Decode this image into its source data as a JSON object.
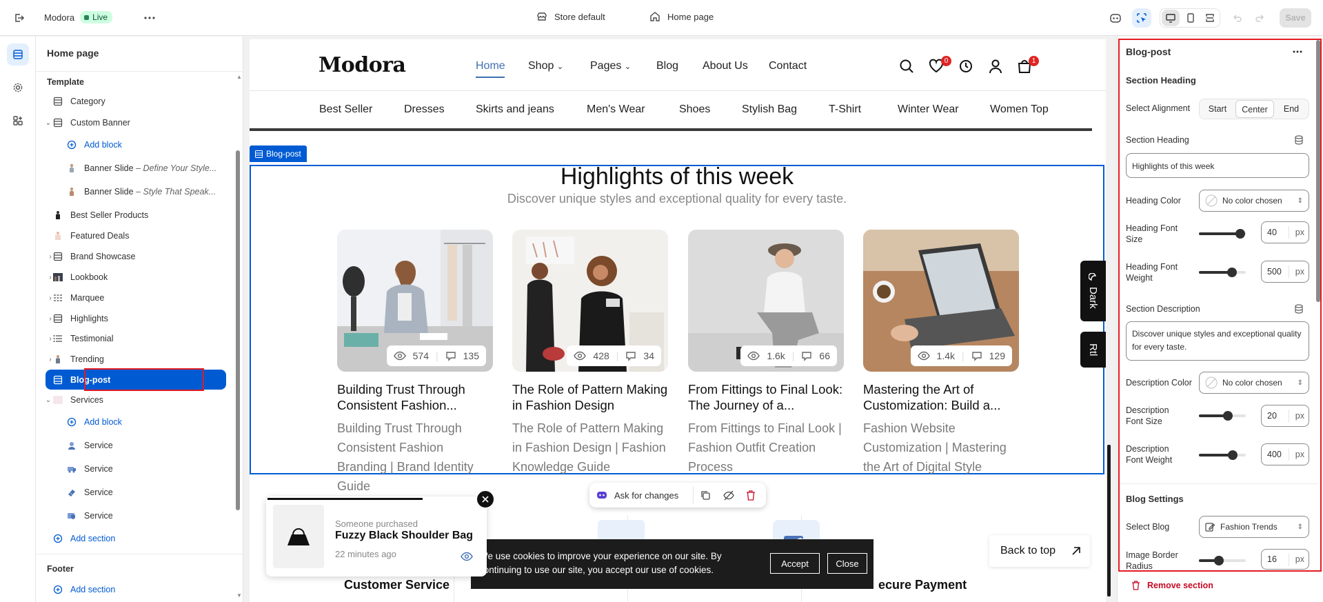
{
  "topbar": {
    "exit_icon": "exit-icon",
    "store_name": "Modora",
    "live_label": "Live",
    "more_icon": "more-icon",
    "theme_label": "Store default",
    "template_label": "Home page",
    "save_label": "Save"
  },
  "sidebar": {
    "title": "Home page",
    "template_group": "Template",
    "footer_group": "Footer",
    "items": [
      {
        "label": "Category"
      },
      {
        "label": "Custom Banner"
      },
      {
        "label": "Add block"
      },
      {
        "label": "Banner Slide",
        "sub": "– Define Your Style..."
      },
      {
        "label": "Banner Slide",
        "sub": "– Style That Speak..."
      },
      {
        "label": "Best Seller Products"
      },
      {
        "label": "Featured Deals"
      },
      {
        "label": "Brand Showcase"
      },
      {
        "label": "Lookbook"
      },
      {
        "label": "Marquee"
      },
      {
        "label": "Highlights"
      },
      {
        "label": "Testimonial"
      },
      {
        "label": "Trending"
      },
      {
        "label": "Blog-post"
      },
      {
        "label": "Services"
      },
      {
        "label": "Add block"
      },
      {
        "label": "Service"
      },
      {
        "label": "Service"
      },
      {
        "label": "Service"
      },
      {
        "label": "Service"
      },
      {
        "label": "Add section"
      }
    ],
    "footer_add": "Add section"
  },
  "site": {
    "logo": "Modora",
    "nav": [
      "Home",
      "Shop",
      "Pages",
      "Blog",
      "About Us",
      "Contact"
    ],
    "wishlist_count": "0",
    "cart_count": "1",
    "categories": [
      "Best Seller",
      "Dresses",
      "Skirts and jeans",
      "Men's Wear",
      "Shoes",
      "Stylish Bag",
      "T-Shirt",
      "Winter Wear",
      "Women Top"
    ]
  },
  "section": {
    "tag": "Blog-post",
    "heading": "Highlights of this week",
    "subheading": "Discover unique styles and exceptional quality for every taste."
  },
  "posts": [
    {
      "title": "Building Trust Through Consistent Fashion...",
      "desc": "Building Trust Through Consistent Fashion Branding | Brand Identity Guide",
      "views": "574",
      "comments": "135"
    },
    {
      "title": "The Role of Pattern Making in Fashion Design",
      "desc": "The Role of Pattern Making in Fashion Design | Fashion Knowledge Guide",
      "views": "428",
      "comments": "34"
    },
    {
      "title": "From Fittings to Final Look: The Journey of a...",
      "desc": "From Fittings to Final Look | Fashion Outfit Creation Process",
      "views": "1.6k",
      "comments": "66"
    },
    {
      "title": "Mastering the Art of Customization: Build a...",
      "desc": "Fashion Website Customization | Mastering the Art of Digital Style",
      "views": "1.4k",
      "comments": "129"
    }
  ],
  "side_tabs": {
    "dark": "Dark",
    "rtl": "Rtl"
  },
  "ask_bar": {
    "label": "Ask for changes"
  },
  "toast": {
    "caption": "Someone purchased",
    "product": "Fuzzy Black Shoulder Bag",
    "time": "22 minutes ago"
  },
  "services": {
    "left": "Customer Service",
    "right": "ecure Payment"
  },
  "cookie": {
    "text": "We use cookies to improve your experience on our site. By continuing to use our site, you accept our use of cookies.",
    "accept": "Accept",
    "close": "Close"
  },
  "back_to_top": "Back to top",
  "panel": {
    "title": "Blog-post",
    "section_heading": "Section Heading",
    "select_alignment": "Select Alignment",
    "align_options": [
      "Start",
      "Center",
      "End"
    ],
    "heading_label": "Section Heading",
    "heading_value": "Highlights of this week",
    "heading_color_label": "Heading Color",
    "no_color": "No color chosen",
    "heading_font_size_label": "Heading Font Size",
    "heading_font_size": "40",
    "heading_font_weight_label": "Heading Font Weight",
    "heading_font_weight": "500",
    "desc_label": "Section Description",
    "desc_value": "Discover unique styles and exceptional quality for every taste.",
    "desc_color_label": "Description Color",
    "desc_font_size_label": "Description Font Size",
    "desc_font_size": "20",
    "desc_font_weight_label": "Description Font Weight",
    "desc_font_weight": "400",
    "blog_settings": "Blog Settings",
    "select_blog_label": "Select Blog",
    "select_blog_value": "Fashion Trends",
    "radius_label": "Image Border Radius",
    "radius_value": "16",
    "unit": "px",
    "remove": "Remove section"
  },
  "slider_levels": {
    "heading_font_size": 0.88,
    "heading_font_weight": 0.7,
    "desc_font_size": 0.62,
    "desc_font_weight": 0.72,
    "radius": 0.42
  }
}
